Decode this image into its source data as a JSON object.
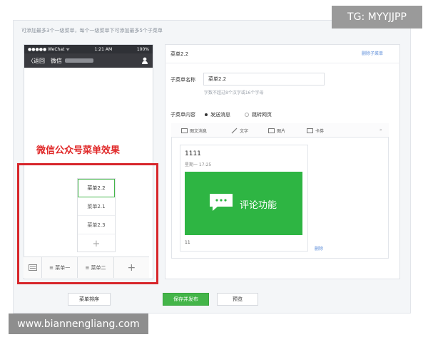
{
  "page": {
    "top_note": "可添加最多3个一级菜单，每个一级菜单下可添加最多5个子菜单",
    "watermark_tg": "TG: MYYJJPP",
    "watermark_site": "www.biannengliang.com"
  },
  "phone": {
    "status": {
      "carrier": "●●●●● WeChat ᯤ",
      "time": "1:21 AM",
      "battery": "100%"
    },
    "nav": {
      "back_label": "〈返回",
      "title": "微信"
    },
    "effect_label": "微信公众号菜单效果",
    "submenu_items": [
      {
        "label": "菜单2.2",
        "selected": true
      },
      {
        "label": "菜单2.1",
        "selected": false
      },
      {
        "label": "菜单2.3",
        "selected": false
      }
    ],
    "submenu_add": "+",
    "menu_bar": [
      "≡ 菜单一",
      "≡ 菜单二",
      "+"
    ]
  },
  "editor": {
    "title": "菜单2.2",
    "delete_submenu": "删除子菜单",
    "name_label": "子菜单名称",
    "name_value": "菜单2.2",
    "name_hint": "字数不超过8个汉字或16个字母",
    "content_label": "子菜单内容",
    "radio_send": "发送消息",
    "radio_link": "跳转网页",
    "tabs": [
      "图文消息",
      "文字",
      "图片",
      "卡券"
    ],
    "tab_more": "»",
    "article": {
      "title": "1111",
      "date": "星期一 17:25",
      "cover_text": "评论功能",
      "footer": "11",
      "delete": "删除"
    }
  },
  "actions": {
    "sort": "菜单排序",
    "save": "保存并发布",
    "preview": "预览"
  },
  "colors": {
    "accent": "#44b549",
    "red": "#d7262b",
    "link": "#5b8cd9"
  }
}
